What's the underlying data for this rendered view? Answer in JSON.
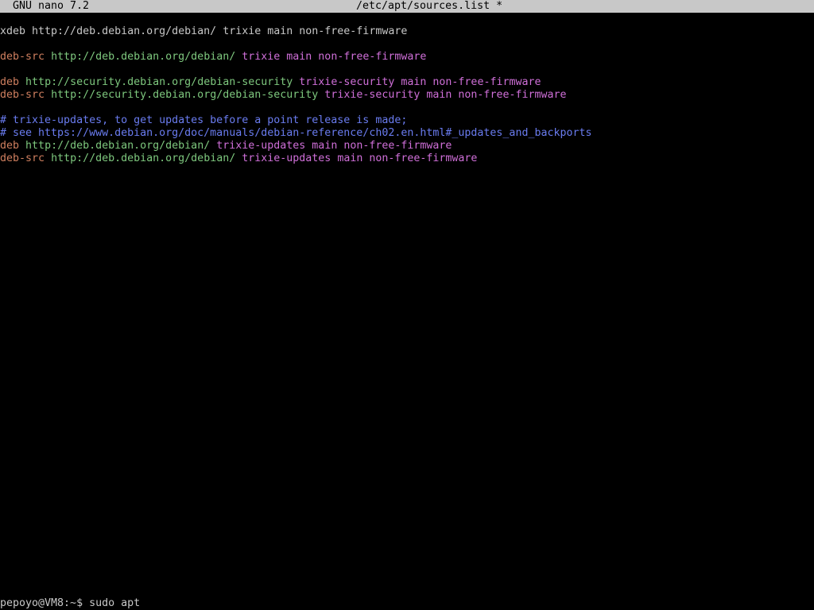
{
  "titlebar": {
    "app": "GNU nano 7.2",
    "file": "/etc/apt/sources.list *"
  },
  "colors": {
    "plain": "#c8c8c8",
    "type": "#cf7f5f",
    "url": "#7ec87e",
    "suite": "#cf6fd8",
    "comment": "#6a7cf0"
  },
  "lines": [
    [
      {
        "text": "xdeb http://deb.debian.org/debian/ trixie main non-free-firmware",
        "kind": "plain"
      }
    ],
    [],
    [
      {
        "text": "deb-src",
        "kind": "type"
      },
      {
        "text": " ",
        "kind": "plain"
      },
      {
        "text": "http://deb.debian.org/debian/",
        "kind": "url"
      },
      {
        "text": " trixie main non-free-firmware",
        "kind": "suite"
      }
    ],
    [],
    [
      {
        "text": "deb",
        "kind": "type"
      },
      {
        "text": " ",
        "kind": "plain"
      },
      {
        "text": "http://security.debian.org/debian-security",
        "kind": "url"
      },
      {
        "text": " trixie-security main non-free-firmware",
        "kind": "suite"
      }
    ],
    [
      {
        "text": "deb-src",
        "kind": "type"
      },
      {
        "text": " ",
        "kind": "plain"
      },
      {
        "text": "http://security.debian.org/debian-security",
        "kind": "url"
      },
      {
        "text": " trixie-security main non-free-firmware",
        "kind": "suite"
      }
    ],
    [],
    [
      {
        "text": "# trixie-updates, to get updates before a point release is made;",
        "kind": "comment"
      }
    ],
    [
      {
        "text": "# see https://www.debian.org/doc/manuals/debian-reference/ch02.en.html#_updates_and_backports",
        "kind": "comment"
      }
    ],
    [
      {
        "text": "deb",
        "kind": "type"
      },
      {
        "text": " ",
        "kind": "plain"
      },
      {
        "text": "http://deb.debian.org/debian/",
        "kind": "url"
      },
      {
        "text": " trixie-updates main non-free-firmware",
        "kind": "suite"
      }
    ],
    [
      {
        "text": "deb-src",
        "kind": "type"
      },
      {
        "text": " ",
        "kind": "plain"
      },
      {
        "text": "http://deb.debian.org/debian/",
        "kind": "url"
      },
      {
        "text": " trixie-updates main non-free-firmware",
        "kind": "suite"
      }
    ]
  ],
  "shell": {
    "prompt": "pepoyo@VM8:~$ sudo apt"
  }
}
